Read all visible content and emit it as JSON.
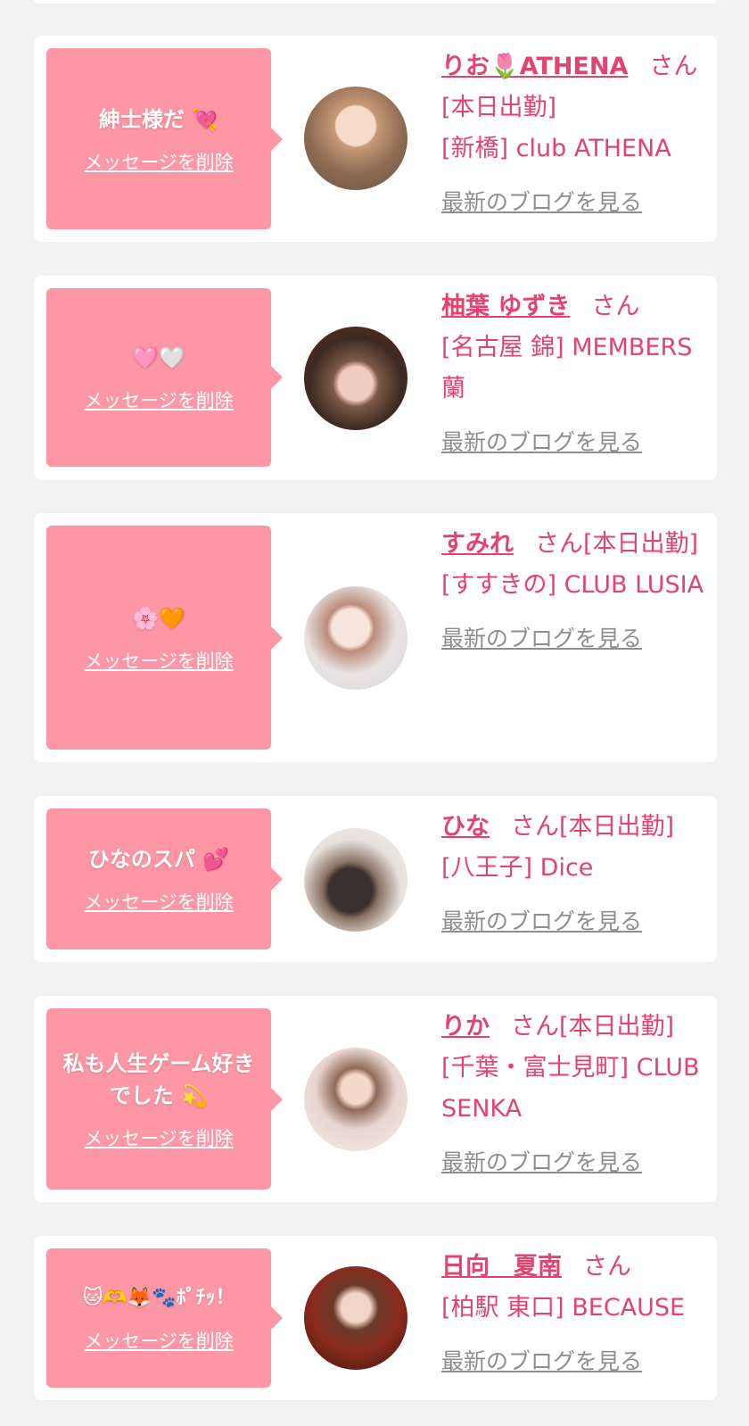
{
  "delete_label": "メッセージを削除",
  "blog_label": "最新のブログを見る",
  "items": [
    {
      "message": "紳士様だ 💘",
      "name": "りお🌷ATHENA",
      "san": "さん[本日出勤]",
      "location": "[新橋] club ATHENA"
    },
    {
      "message": "🩷🤍",
      "name": "柚葉 ゆずき",
      "san": "さん",
      "location": "[名古屋 錦] MEMBERS 蘭"
    },
    {
      "message": "🌸🧡",
      "name": "すみれ",
      "san": "さん[本日出勤]",
      "location": "[すすきの] CLUB LUSIA"
    },
    {
      "message": "ひなのスパ 💕",
      "name": "ひな",
      "san": "さん[本日出勤]",
      "location": "[八王子] Dice"
    },
    {
      "message": "私も人生ゲーム好きでした 💫",
      "name": "りか",
      "san": "さん[本日出勤]",
      "location": "[千葉・富士見町] CLUB SENKA"
    },
    {
      "message": "🐱🫶🦊🐾ﾎﾟﾁｯ！",
      "name": "日向　夏南",
      "san": "さん",
      "location": "[柏駅 東口] BECAUSE"
    }
  ],
  "colors": {
    "accent": "#e2436f",
    "bubble": "#fd97a6",
    "muted": "#8e8e8e",
    "background": "#f2f2f2"
  },
  "icons": [
    "avatar-photo",
    "speech-bubble-arrow"
  ]
}
